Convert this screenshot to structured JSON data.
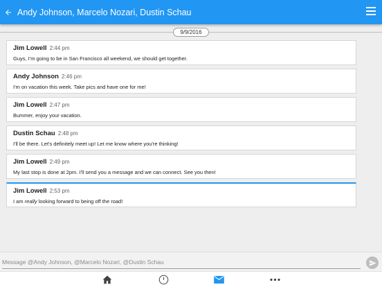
{
  "header": {
    "title": "Andy Johnson, Marcelo Nozari, Dustin Schau",
    "back_icon": "arrow-left-icon",
    "menu_icon": "hamburger-menu-icon",
    "color": "#2196f3"
  },
  "conversation": {
    "date": "9/9/2016",
    "messages": [
      {
        "sender": "Jim Lowell",
        "time": "2:44 pm",
        "text": "Guys, I'm going to be in San Francisco all weekend, we should get together."
      },
      {
        "sender": "Andy Johnson",
        "time": "2:46 pm",
        "text": "I'm on vacation this week. Take pics and have one for me!"
      },
      {
        "sender": "Jim Lowell",
        "time": "2:47 pm",
        "text": "Bummer, enjoy your vacation."
      },
      {
        "sender": "Dustin Schau",
        "time": "2:48 pm",
        "text": "I'll be there. Let's definitely meet up! Let me know where you're thinking!"
      },
      {
        "sender": "Jim Lowell",
        "time": "2:49 pm",
        "text": "My last stop is done at 2pm. I'll send you a message and we can connect. See you then!"
      },
      {
        "sender": "Jim Lowell",
        "time": "2:53 pm",
        "text_before": "I am ",
        "text_emphasis": "really",
        "text_after": " looking forward to being off the road!"
      }
    ]
  },
  "compose": {
    "placeholder": "Message @Andy Johnson, @Marcelo Nozari, @Dustin Schau",
    "value": "",
    "send_icon": "send-icon"
  },
  "bottom_nav": {
    "items": [
      {
        "icon": "home-icon"
      },
      {
        "icon": "clock-icon"
      },
      {
        "icon": "mail-icon",
        "active": true
      },
      {
        "icon": "more-dots-icon"
      }
    ]
  }
}
